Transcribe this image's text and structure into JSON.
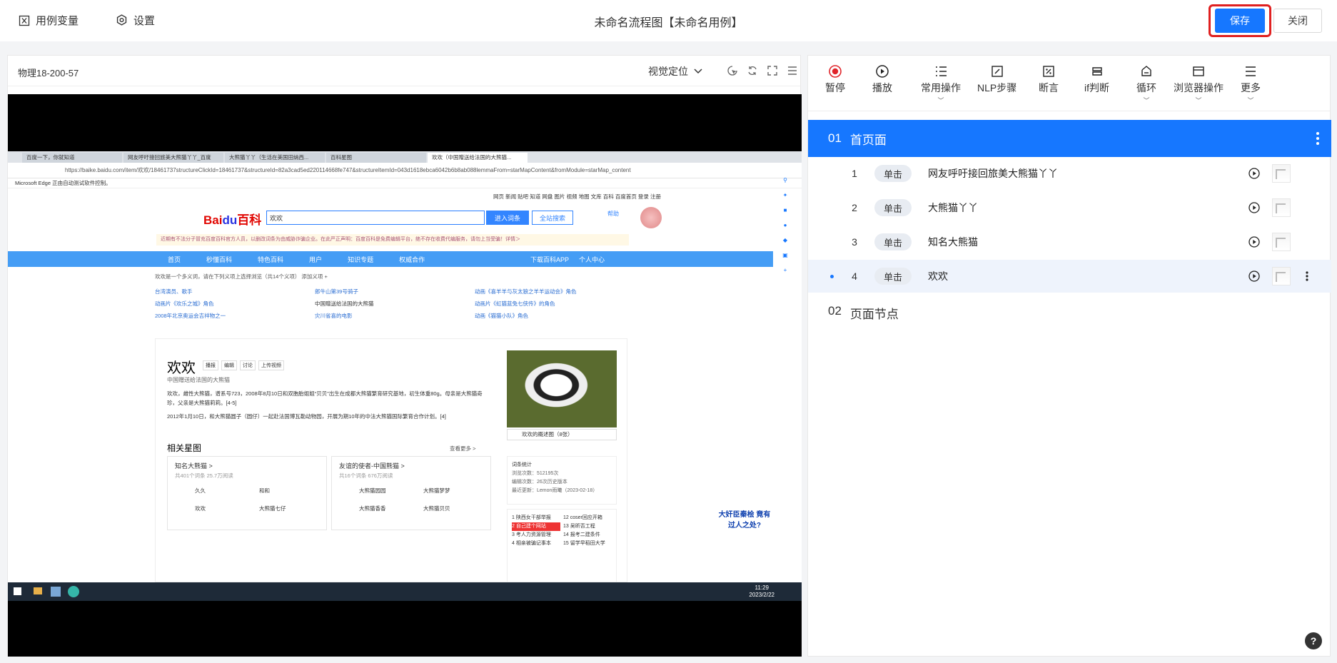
{
  "topbar": {
    "variables_label": "用例变量",
    "settings_label": "设置",
    "title": "未命名流程图【未命名用例】",
    "save_label": "保存",
    "close_label": "关闭"
  },
  "left_panel": {
    "device_name": "物理18-200-57",
    "visual_position_label": "视觉定位"
  },
  "screen": {
    "browser_tabs": [
      "百度一下，你就知道",
      "网友呼吁接回旅美大熊猫丫丫_百度",
      "大熊猫丫丫（生活在美国田纳西...",
      "百科星图",
      "欢欢（中国赠送给法国的大熊猫..."
    ],
    "url": "https://baike.baidu.com/item/欢欢/18461737structureClickId=18461737&structureId=82a3cad5ed220114668fe747&structureItemId=043d1618ebca6042b6b8ab088lemmaFrom=starMapContent&fromModule=starMap_content",
    "edge_notice": "Microsoft Edge 正由自动测试软件控制。",
    "top_links": "网页  新闻  贴吧  知道  网盘  图片  视频  地图  文库  百科    百度首页  登录  注册",
    "logo_red": "Bai",
    "logo_blue": "du",
    "logo_suffix": "百科",
    "search_value": "欢欢",
    "enter_label": "进入词条",
    "search_all_label": "全站搜索",
    "help_label": "帮助",
    "notice": "近期有不法分子冒充百度百科官方人员，以删改词条为由威胁诈骗企业。在此严正声明：百度百科是免费编辑平台，绝不存在收费代编服务，请勿上当受骗！详情＞",
    "nav": [
      "首页",
      "秒懂百科",
      "特色百科",
      "用户",
      "知识专题",
      "权威合作"
    ],
    "nav_right": [
      "下载百科APP",
      "个人中心"
    ],
    "poly_header": "欢欢是一个多义词，请在下列义项上选择浏览（共14个义项）    添加义项 +",
    "poly_items": [
      "台湾演员、歌手",
      "郎牛山第39号骑子",
      "动画《喜羊羊与灰太狼之羊羊运动会》角色",
      "动画片《欢乐之城》角色",
      "中国赠送给法国的大熊猫",
      "动画片《虹猫蓝兔七侠传》的角色",
      "2008年北京奥运会吉祥物之一",
      "灾川省喜的电影",
      "动画《猫猫小队》角色"
    ],
    "entry_title": "欢欢",
    "entry_actions": [
      "播报",
      "编辑",
      "讨论",
      "上传视频"
    ],
    "entry_sub": "中国赠送给法国的大熊猫",
    "entry_desc1": "欢欢，雌性大熊猫，谱系号723，2008年8月10日和双胞胎姐姐“贝贝”出生在成都大熊猫繁育研究基地，初生体重80g。母亲是大熊猫奇珍，父亲是大熊猫莉莉。[4-5]",
    "entry_desc2": "2012年1月10日，和大熊猫圆子（圆仔）一起赴法国博瓦勒动物园，开展为期10年的中法大熊猫国际繁育合作计划。[4]",
    "panda_caption": "欢欢的概述图（8张）",
    "related_title": "相关星图",
    "related_more": "查看更多 >",
    "card1_title": "知名大熊猫 >",
    "card1_meta": "共401个词条  25.7万阅读",
    "card1_items": [
      "久久",
      "和和",
      "欢欢",
      "大熊猫七仔"
    ],
    "card2_title": "友谊的使者-中国熊猫 >",
    "card2_meta": "共16个词条  676万阅读",
    "card2_items": [
      "大熊猫园园",
      "大熊猫梦梦",
      "大熊猫香香",
      "大熊猫贝贝"
    ],
    "stats_title": "词条统计",
    "stats_lines": [
      "浏览次数：512195次",
      "编辑次数：26次历史版本",
      "最近更新：Lemon雨曦（2023-02-18）"
    ],
    "hot_items": [
      "1 陕西女干部举报",
      "12 coser回应开箱",
      "2 自己建个网站",
      "13 吴昕否工程",
      "3 考人力资源管理",
      "14 报考二建条件",
      "4 相亲被骗记事本",
      "15 留学早稻田大学"
    ],
    "ad_text": "大奸臣秦桧 竟有过人之处?",
    "clock_time": "11:29",
    "clock_date": "2023/2/22"
  },
  "toolbox": [
    {
      "label": "暂停",
      "icon": "record-stop-icon"
    },
    {
      "label": "播放",
      "icon": "play-circle-icon"
    },
    {
      "label": "常用操作",
      "icon": "list-icon",
      "dropdown": true
    },
    {
      "label": "NLP步骤",
      "icon": "edit-box-icon"
    },
    {
      "label": "断言",
      "icon": "percent-box-icon"
    },
    {
      "label": "if判断",
      "icon": "branch-icon"
    },
    {
      "label": "循环",
      "icon": "loop-icon",
      "dropdown": true
    },
    {
      "label": "浏览器操作",
      "icon": "browser-window-icon",
      "dropdown": true
    },
    {
      "label": "更多",
      "icon": "menu-lines-icon",
      "dropdown": true
    }
  ],
  "flow": {
    "section1": {
      "index": "01",
      "title": "首页面"
    },
    "steps": [
      {
        "num": "1",
        "action": "单击",
        "desc": "网友呼吁接回旅美大熊猫丫丫"
      },
      {
        "num": "2",
        "action": "单击",
        "desc": "大熊猫丫丫"
      },
      {
        "num": "3",
        "action": "单击",
        "desc": "知名大熊猫"
      },
      {
        "num": "4",
        "action": "单击",
        "desc": "欢欢"
      }
    ],
    "section2": {
      "index": "02",
      "title": "页面节点"
    }
  },
  "help": "?",
  "colors": {
    "accent": "#1677ff",
    "highlight_border": "#e02020"
  }
}
